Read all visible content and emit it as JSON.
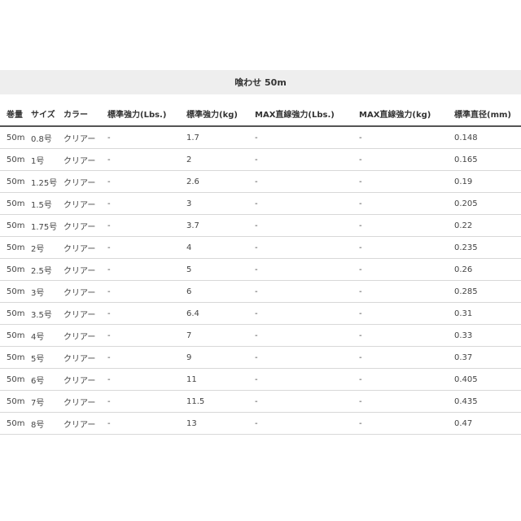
{
  "caption": "喰わせ 50m",
  "table": {
    "headers": [
      "巻量",
      "サイズ",
      "カラー",
      "標準強力(Lbs.)",
      "標準強力(kg)",
      "MAX直線強力(Lbs.)",
      "MAX直線強力(kg)",
      "標準直径(mm)"
    ],
    "rows": [
      [
        "50m",
        "0.8号",
        "クリアー",
        "-",
        "1.7",
        "-",
        "-",
        "0.148"
      ],
      [
        "50m",
        "1号",
        "クリアー",
        "-",
        "2",
        "-",
        "-",
        "0.165"
      ],
      [
        "50m",
        "1.25号",
        "クリアー",
        "-",
        "2.6",
        "-",
        "-",
        "0.19"
      ],
      [
        "50m",
        "1.5号",
        "クリアー",
        "-",
        "3",
        "-",
        "-",
        "0.205"
      ],
      [
        "50m",
        "1.75号",
        "クリアー",
        "-",
        "3.7",
        "-",
        "-",
        "0.22"
      ],
      [
        "50m",
        "2号",
        "クリアー",
        "-",
        "4",
        "-",
        "-",
        "0.235"
      ],
      [
        "50m",
        "2.5号",
        "クリアー",
        "-",
        "5",
        "-",
        "-",
        "0.26"
      ],
      [
        "50m",
        "3号",
        "クリアー",
        "-",
        "6",
        "-",
        "-",
        "0.285"
      ],
      [
        "50m",
        "3.5号",
        "クリアー",
        "-",
        "6.4",
        "-",
        "-",
        "0.31"
      ],
      [
        "50m",
        "4号",
        "クリアー",
        "-",
        "7",
        "-",
        "-",
        "0.33"
      ],
      [
        "50m",
        "5号",
        "クリアー",
        "-",
        "9",
        "-",
        "-",
        "0.37"
      ],
      [
        "50m",
        "6号",
        "クリアー",
        "-",
        "11",
        "-",
        "-",
        "0.405"
      ],
      [
        "50m",
        "7号",
        "クリアー",
        "-",
        "11.5",
        "-",
        "-",
        "0.435"
      ],
      [
        "50m",
        "8号",
        "クリアー",
        "-",
        "13",
        "-",
        "-",
        "0.47"
      ]
    ]
  }
}
